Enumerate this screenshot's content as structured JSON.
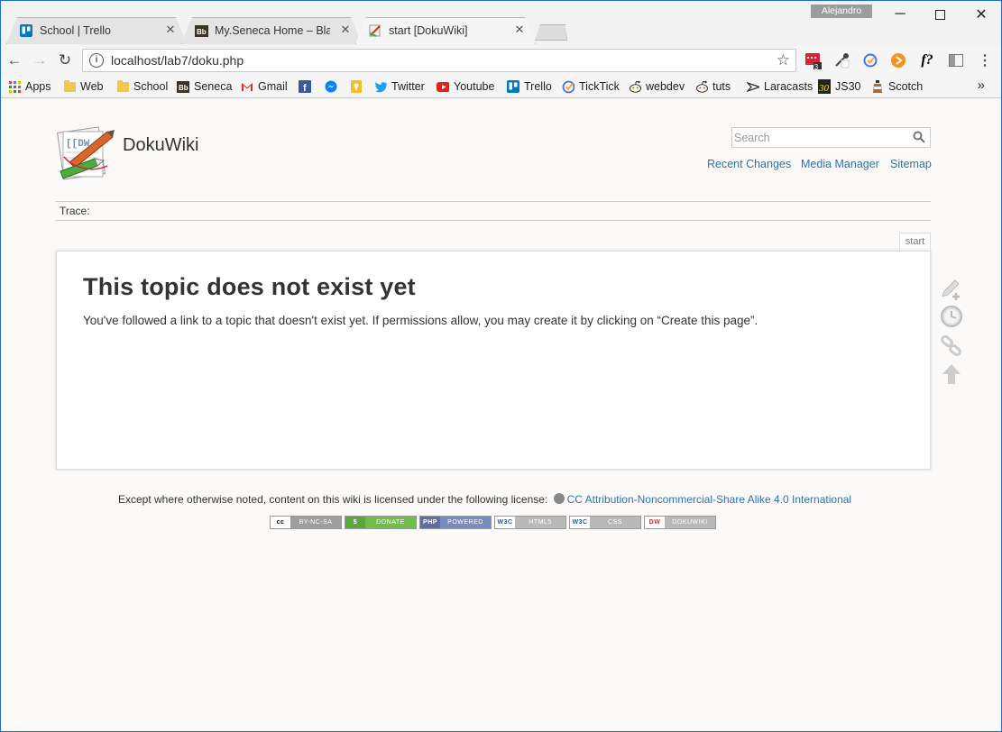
{
  "profile": {
    "name": "Alejandro"
  },
  "tabs": [
    {
      "title": "School | Trello",
      "icon": "trello-icon"
    },
    {
      "title": "My.Seneca Home – Blackboard",
      "icon": "blackboard-icon"
    },
    {
      "title": "start [DokuWiki]",
      "icon": "dokuwiki-icon"
    }
  ],
  "omnibox": {
    "url": "localhost/lab7/doku.php"
  },
  "extensions": {
    "badge_count": "3"
  },
  "bookmarks": [
    {
      "label": "Apps"
    },
    {
      "label": "Web"
    },
    {
      "label": "School"
    },
    {
      "label": "Seneca"
    },
    {
      "label": "Gmail"
    },
    {
      "label": ""
    },
    {
      "label": ""
    },
    {
      "label": ""
    },
    {
      "label": "Twitter"
    },
    {
      "label": "Youtube"
    },
    {
      "label": "Trello"
    },
    {
      "label": "TickTick"
    },
    {
      "label": "webdev"
    },
    {
      "label": "tuts"
    },
    {
      "label": "Laracasts"
    },
    {
      "label": "JS30"
    },
    {
      "label": "Scotch"
    }
  ],
  "wiki": {
    "title": "DokuWiki",
    "search_placeholder": "Search",
    "links": [
      "Recent Changes",
      "Media Manager",
      "Sitemap"
    ],
    "trace_label": "Trace:",
    "page_id": "start",
    "heading": "This topic does not exist yet",
    "message": "You've followed a link to a topic that doesn't exist yet. If permissions allow, you may create it by clicking on “Create this page”.",
    "license_text": "Except where otherwise noted, content on this wiki is licensed under the following license:",
    "license_link": "CC Attribution-Noncommercial-Share Alike 4.0 International",
    "badges": [
      {
        "left": "cc",
        "right": "BY-NC-SA",
        "color": "#9e9e9e"
      },
      {
        "left": "$",
        "right": "DONATE",
        "color": "#6fbf4a"
      },
      {
        "left": "PHP",
        "right": "POWERED",
        "color": "#6a7fb5"
      },
      {
        "left": "W3C",
        "right": "HTML5",
        "color": "#b9b9b9"
      },
      {
        "left": "W3C",
        "right": "CSS",
        "color": "#b9b9b9"
      },
      {
        "left": "DW",
        "right": "DOKUWIKI",
        "color": "#b9b9b9"
      }
    ]
  },
  "colors": {
    "link": "#2b73b7",
    "window_border": "#1e6fcc"
  }
}
